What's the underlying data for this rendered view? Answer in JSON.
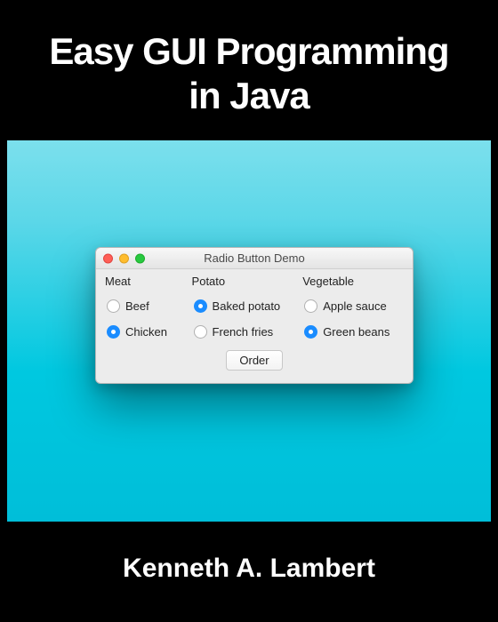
{
  "cover": {
    "title_line1": "Easy GUI Programming",
    "title_line2": "in Java",
    "author": "Kenneth A. Lambert"
  },
  "window": {
    "title": "Radio Button Demo",
    "columns": [
      {
        "header": "Meat",
        "options": [
          {
            "label": "Beef",
            "checked": false
          },
          {
            "label": "Chicken",
            "checked": true
          }
        ]
      },
      {
        "header": "Potato",
        "options": [
          {
            "label": "Baked potato",
            "checked": true
          },
          {
            "label": "French fries",
            "checked": false
          }
        ]
      },
      {
        "header": "Vegetable",
        "options": [
          {
            "label": "Apple sauce",
            "checked": false
          },
          {
            "label": "Green beans",
            "checked": true
          }
        ]
      }
    ],
    "button_label": "Order"
  }
}
